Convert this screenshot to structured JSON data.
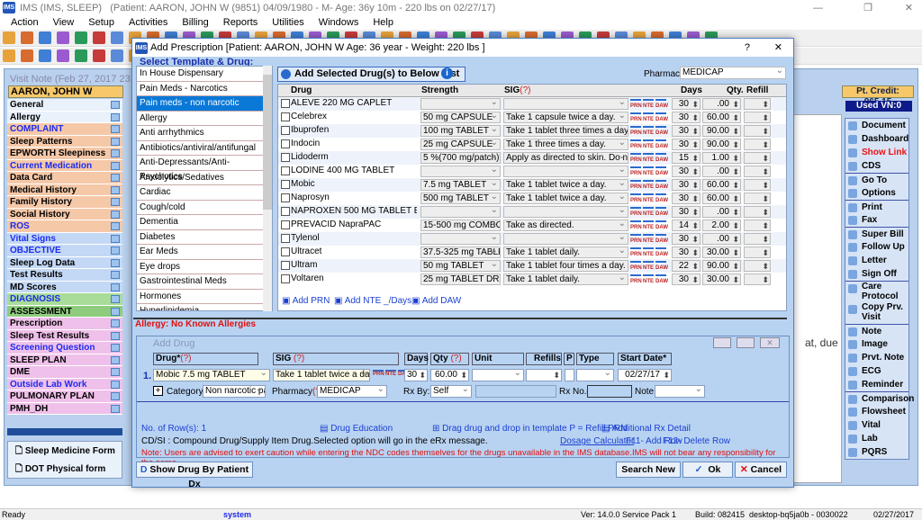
{
  "app": {
    "title": "IMS (IMS, SLEEP)",
    "patient_info": "(Patient: AARON, JOHN W (9851) 04/09/1980 - M- Age: 36y 10m - 220 lbs on 02/27/17)"
  },
  "menu": [
    "Action",
    "View",
    "Setup",
    "Activities",
    "Billing",
    "Reports",
    "Utilities",
    "Windows",
    "Help"
  ],
  "visit_note": {
    "title": "Visit Note (Feb 27, 2017   231 of",
    "patient_name": "AARON, JOHN W",
    "pt_credit": "Pt. Credit: 965.15",
    "used_vn": "Used VN:0",
    "note_fragment": "at, due"
  },
  "sidebar": {
    "items": [
      {
        "label": "General",
        "color": "#e9f1fb",
        "text": "#000"
      },
      {
        "label": "Allergy",
        "color": "#e9f1fb",
        "text": "#000"
      },
      {
        "label": "COMPLAINT",
        "color": "#f5c8a8",
        "text": "#1b2bf0"
      },
      {
        "label": "Sleep Patterns",
        "color": "#f5c8a8",
        "text": "#000"
      },
      {
        "label": "EPWORTH Sleepiness",
        "color": "#f5c8a8",
        "text": "#000"
      },
      {
        "label": "Current Medication",
        "color": "#f5c8a8",
        "text": "#1b2bf0"
      },
      {
        "label": "Data Card",
        "color": "#f5c8a8",
        "text": "#000"
      },
      {
        "label": "Medical History",
        "color": "#f5c8a8",
        "text": "#000"
      },
      {
        "label": "Family History",
        "color": "#f5c8a8",
        "text": "#000"
      },
      {
        "label": "Social History",
        "color": "#f5c8a8",
        "text": "#000"
      },
      {
        "label": "ROS",
        "color": "#f5c8a8",
        "text": "#1b2bf0"
      },
      {
        "label": "Vital Signs",
        "color": "#c3d8f5",
        "text": "#1b2bf0"
      },
      {
        "label": "OBJECTIVE",
        "color": "#c3d8f5",
        "text": "#1b2bf0"
      },
      {
        "label": "Sleep Log Data",
        "color": "#c3d8f5",
        "text": "#000"
      },
      {
        "label": "Test Results",
        "color": "#c3d8f5",
        "text": "#000"
      },
      {
        "label": "MD Scores",
        "color": "#c3d8f5",
        "text": "#000"
      },
      {
        "label": "DIAGNOSIS",
        "color": "#a8dc98",
        "text": "#1b2bf0"
      },
      {
        "label": "ASSESSMENT",
        "color": "#8fcc7e",
        "text": "#000"
      },
      {
        "label": "Prescription",
        "color": "#efc0ea",
        "text": "#000"
      },
      {
        "label": "Sleep Test Results",
        "color": "#efc0ea",
        "text": "#000"
      },
      {
        "label": "Screening Question",
        "color": "#efc0ea",
        "text": "#1b2bf0"
      },
      {
        "label": "SLEEP PLAN",
        "color": "#efc0ea",
        "text": "#000"
      },
      {
        "label": "DME",
        "color": "#efc0ea",
        "text": "#000"
      },
      {
        "label": "Outside Lab Work",
        "color": "#efc0ea",
        "text": "#1b2bf0"
      },
      {
        "label": "PULMONARY PLAN",
        "color": "#efc0ea",
        "text": "#000"
      },
      {
        "label": "PMH_DH",
        "color": "#efc0ea",
        "text": "#000"
      }
    ],
    "forms": [
      "Sleep Medicine Form",
      "DOT Physical form"
    ]
  },
  "right_panel": [
    {
      "group": [
        "Document",
        "Dashboard",
        "Show Link",
        "CDS"
      ]
    },
    {
      "group": [
        "Go To",
        "Options"
      ]
    },
    {
      "group": [
        "Print",
        "Fax"
      ]
    },
    {
      "group": [
        "Super Bill",
        "Follow Up",
        "Letter",
        "Sign Off"
      ]
    },
    {
      "group": [
        "Care Protocol",
        "Copy Prv. Visit"
      ]
    },
    {
      "group": [
        "Note",
        "Image",
        "Prvt. Note",
        "ECG",
        "Reminder"
      ]
    },
    {
      "group": [
        "Comparison",
        "Flowsheet",
        "Vital",
        "Lab",
        "PQRS"
      ]
    }
  ],
  "show_link_color": "#ee1111",
  "dialog": {
    "title": "Add Prescription  [Patient: AARON, JOHN W  Age: 36 year  - Weight: 220 lbs ]",
    "help": "?",
    "close": "✕",
    "select_label": "Select Template & Drug:",
    "templates": [
      "In House Dispensary",
      "Pain Meds - Narcotics",
      "Pain meds - non narcotic",
      "Allergy",
      "Anti arrhythmics",
      "Antibiotics/antiviral/antifungal",
      "Anti-Depressants/Anti- Psychotics",
      "Anxiolytics/Sedatives",
      "Cardiac",
      "Cough/cold",
      "Dementia",
      "Diabetes",
      "Ear Meds",
      "Eye drops",
      "Gastrointestinal Meds",
      "Hormones",
      "Hyperlipidemia"
    ],
    "selected_template": "Pain meds - non narcotic",
    "add_selected": "Add Selected Drug(s) to Below List",
    "pharmacy_label": "Pharmacy:",
    "pharmacy": "MEDICAP",
    "columns": {
      "drug": "Drug",
      "strength": "Strength",
      "sig": "SIG",
      "sig_help": "(?)",
      "days": "Days",
      "qty": "Qty.",
      "refill": "Refill"
    },
    "drugs": [
      {
        "drug": "ALEVE 220 MG CAPLET",
        "strength": "",
        "sig": "",
        "days": "30",
        "qty": ".00"
      },
      {
        "drug": "Celebrex",
        "strength": "50 mg CAPSULE",
        "sig": "Take 1 capsule twice a day.",
        "days": "30",
        "qty": "60.00"
      },
      {
        "drug": "Ibuprofen",
        "strength": "100 mg TABLET",
        "sig": "Take 1 tablet three times a day.",
        "days": "30",
        "qty": "90.00"
      },
      {
        "drug": "Indocin",
        "strength": "25 mg CAPSULE",
        "sig": "Take 1 three times a day.",
        "days": "30",
        "qty": "90.00"
      },
      {
        "drug": "Lidoderm",
        "strength": "5 %(700 mg/patch) A",
        "sig": "Apply as directed to skin.  Do not l",
        "days": "15",
        "qty": "1.00"
      },
      {
        "drug": "LODINE 400 MG TABLET",
        "strength": "",
        "sig": "",
        "days": "30",
        "qty": ".00"
      },
      {
        "drug": "Mobic",
        "strength": "7.5 mg TABLET",
        "sig": "Take 1 tablet twice a day.",
        "days": "30",
        "qty": "60.00"
      },
      {
        "drug": "Naprosyn",
        "strength": "500 mg TABLET",
        "sig": "Take 1 tablet twice a day.",
        "days": "30",
        "qty": "60.00"
      },
      {
        "drug": "NAPROXEN 500 MG TABLET EC",
        "strength": "",
        "sig": "",
        "days": "30",
        "qty": ".00"
      },
      {
        "drug": "PREVACID NapraPAC",
        "strength": "15-500 mg COMBO.",
        "sig": "Take as directed.",
        "days": "14",
        "qty": "2.00"
      },
      {
        "drug": "Tylenol",
        "strength": "",
        "sig": "",
        "days": "30",
        "qty": ".00"
      },
      {
        "drug": "Ultracet",
        "strength": "37.5-325 mg TABLE",
        "sig": "Take 1 tablet daily.",
        "days": "30",
        "qty": "30.00"
      },
      {
        "drug": "Ultram",
        "strength": "50 mg TABLET",
        "sig": "Take 1 tablet four times a day.",
        "days": "22",
        "qty": "90.00"
      },
      {
        "drug": "Voltaren",
        "strength": "25 mg TABLET DR",
        "sig": "Take 1 tablet daily.",
        "days": "30",
        "qty": "30.00"
      }
    ],
    "row_icons": [
      "PRN",
      "NTE",
      "DAW"
    ],
    "add_prn": "Add PRN",
    "add_nte": "Add NTE _/Days",
    "add_daw": "Add DAW",
    "allergy": "Allergy: No Known Allergies",
    "add_drug": {
      "title": "Add Drug",
      "headers": {
        "drug": "Drug*",
        "drug_help": "(?)",
        "sig": "SIG",
        "sig_help": "(?)",
        "days": "Days",
        "qty": "Qty",
        "qty_help": "(?)",
        "unit": "Unit",
        "refills": "Refills",
        "p": "P",
        "type": "Type",
        "start_date": "Start Date*"
      },
      "row_num": "1.",
      "drug": "Mobic 7.5 mg TABLET",
      "sig": "Take 1 tablet twice a day.",
      "days": "30",
      "qty": "60.00",
      "unit": "",
      "refills": "",
      "type": "",
      "start_date": "02/27/17",
      "category_label": "Category:",
      "category": "Non narcotic pa",
      "pharmacy_label": "Pharmacy",
      "pharmacy_help": "(?)",
      "pharmacy": "MEDICAP",
      "rxby_label": "Rx By:",
      "rxby": "Self",
      "rxno_label": "Rx No.#",
      "note_label": "Note:",
      "rows_count": "No. of Row(s): 1",
      "drug_education": "Drug Education",
      "drag_hint": "Drag drug and drop in template  P = Refill PRN",
      "additional_detail": "Additional Rx Detail",
      "cdsi": "CD/SI : Compound Drug/Supply Item Drug.Selected option will go in the eRx message.",
      "dosage_calc": "Dosage Calculator",
      "f11": "F11- Add Row",
      "f12": "F12- Delete Row",
      "note_warning": "Note: Users are advised to exert caution while entering the NDC codes themselves for the drugs unavailable in the IMS database.IMS will not bear any responsibility for the same."
    },
    "show_drug_dx": "Show Drug By Patient Dx",
    "search_new": "Search New",
    "ok": "Ok",
    "cancel": "Cancel"
  },
  "status": {
    "ready": "Ready",
    "user": "system",
    "version": "Ver: 14.0.0 Service Pack 1",
    "build": "Build: 082415",
    "machine": "desktop-bq5ja0b - 0030022",
    "date": "02/27/2017"
  }
}
